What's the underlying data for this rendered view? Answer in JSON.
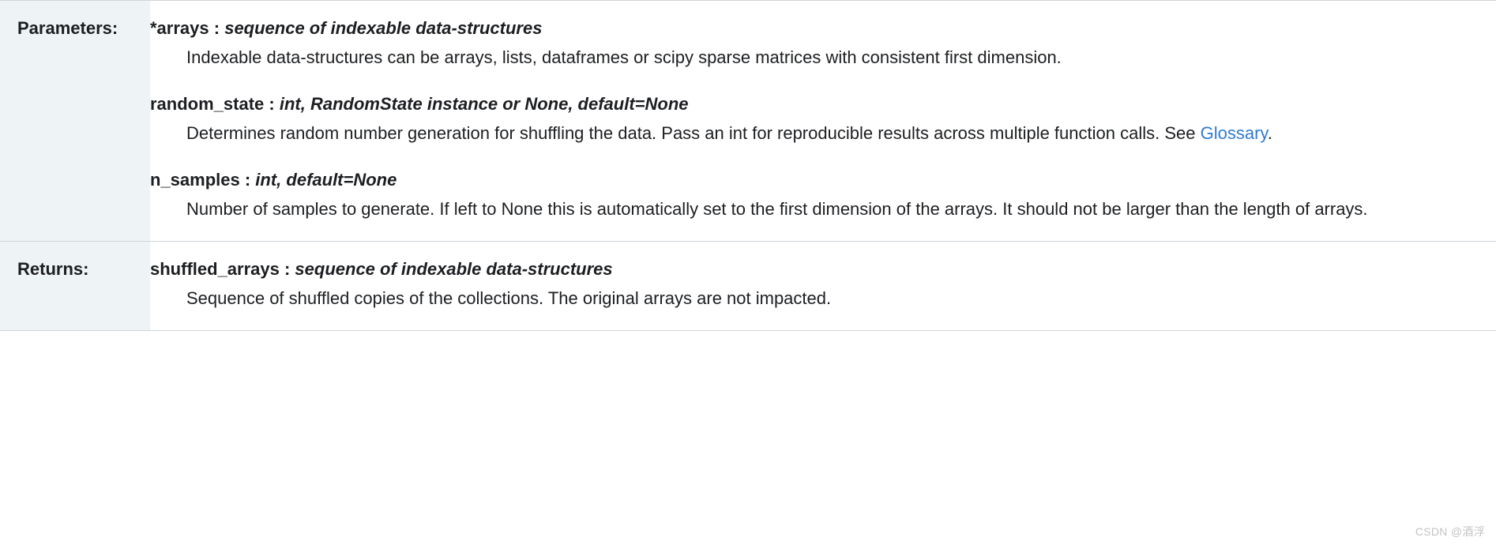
{
  "sections": {
    "parameters": {
      "label": "Parameters:",
      "items": [
        {
          "name": "*arrays",
          "sep": " : ",
          "type": "sequence of indexable data-structures",
          "desc_before": "Indexable data-structures can be arrays, lists, dataframes or scipy sparse matrices with consistent first dimension.",
          "link_text": "",
          "desc_after": ""
        },
        {
          "name": "random_state",
          "sep": " : ",
          "type": "int, RandomState instance or None, default=None",
          "desc_before": "Determines random number generation for shuffling the data. Pass an int for reproducible results across multiple function calls. See ",
          "link_text": "Glossary",
          "desc_after": "."
        },
        {
          "name": "n_samples",
          "sep": " : ",
          "type": "int, default=None",
          "desc_before": "Number of samples to generate. If left to None this is automatically set to the first dimension of the arrays. It should not be larger than the length of arrays.",
          "link_text": "",
          "desc_after": ""
        }
      ]
    },
    "returns": {
      "label": "Returns:",
      "items": [
        {
          "name": "shuffled_arrays",
          "sep": " : ",
          "type": "sequence of indexable data-structures",
          "desc_before": "Sequence of shuffled copies of the collections. The original arrays are not impacted.",
          "link_text": "",
          "desc_after": ""
        }
      ]
    }
  },
  "watermark": "CSDN @酒浮"
}
